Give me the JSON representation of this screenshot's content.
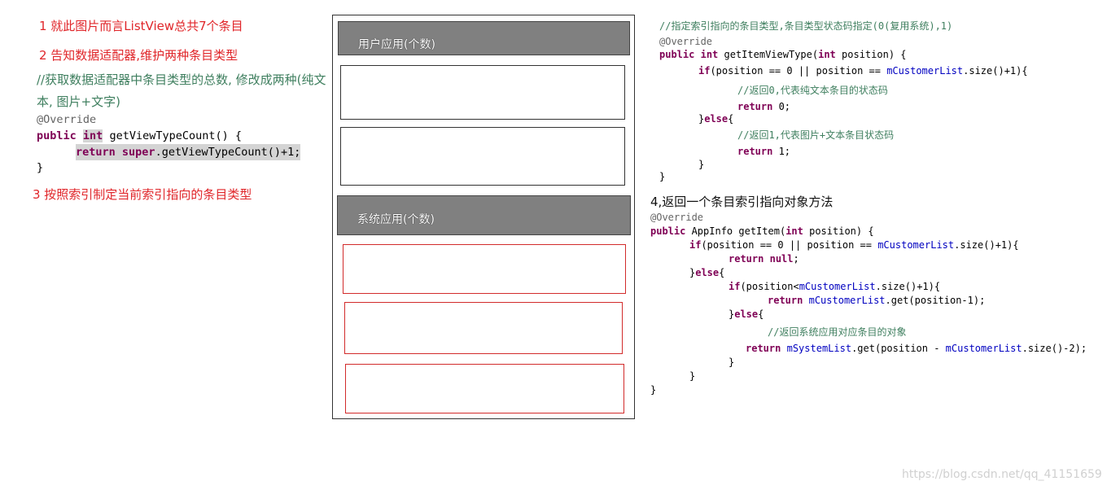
{
  "left": {
    "note1": "1 就此图片而言ListView总共7个条目",
    "note2": "2 告知数据适配器,维护两种条目类型",
    "comment_line1": "//获取数据适配器中条目类型的总数, 修改成两种(纯文",
    "comment_line2": "本, 图片+文字)",
    "code": {
      "annotation": "@Override",
      "sig_public": "public",
      "sig_int": "int",
      "sig_rest": " getViewTypeCount() {",
      "ret_return": "return",
      "ret_super": "super",
      "ret_rest": ".getViewTypeCount()+1;",
      "close": "}"
    },
    "note3": "3  按照索引制定当前索引指向的条目类型"
  },
  "phone": {
    "user_header": "用户应用(个数)",
    "system_header": "系统应用(个数)"
  },
  "right_top": {
    "comment": "//指定索引指向的条目类型,条目类型状态码指定(0(复用系统),1)",
    "annotation": "@Override",
    "l1_public": "public",
    "l1_int": "int",
    "l1_name": " getItemViewType(",
    "l1_int2": "int",
    "l1_rest": " position) {",
    "l2_if": "if",
    "l2_a": "(position == 0 || position == ",
    "l2_field": "mCustomerList",
    "l2_b": ".size()+1){",
    "l3_comment": "//返回0,代表纯文本条目的状态码",
    "l4_return": "return",
    "l4_rest": " 0;",
    "l5": "}",
    "l5_else": "else",
    "l5_b": "{",
    "l6_comment": "//返回1,代表图片+文本条目状态码",
    "l7_return": "return",
    "l7_rest": " 1;",
    "l8": "}",
    "l9": "}"
  },
  "right_bottom": {
    "heading": "4,返回一个条目索引指向对象方法",
    "annotation": "@Override",
    "l1_public": "public",
    "l1_a": " AppInfo getItem(",
    "l1_int": "int",
    "l1_b": " position) {",
    "l2_if": "if",
    "l2_a": "(position == 0 || position == ",
    "l2_field": "mCustomerList",
    "l2_b": ".size()+1){",
    "l3_return": "return",
    "l3_null": "null",
    "l3_semi": ";",
    "l4_a": "}",
    "l4_else": "else",
    "l4_b": "{",
    "l5_if": "if",
    "l5_a": "(position<",
    "l5_field": "mCustomerList",
    "l5_b": ".size()+1){",
    "l6_return": "return",
    "l6_field": "mCustomerList",
    "l6_b": ".get(position-1);",
    "l7_a": "}",
    "l7_else": "else",
    "l7_b": "{",
    "l8_comment": "//返回系统应用对应条目的对象",
    "l9_return": "return",
    "l9_field": "mSystemList",
    "l9_a": ".get(position - ",
    "l9_field2": "mCustomerList",
    "l9_b": ".size()-2);",
    "l10": "}",
    "l11": "}",
    "l12": "}"
  },
  "watermark": "https://blog.csdn.net/qq_41151659",
  "colors": {
    "note_red": "#e0262a",
    "comment_green": "#3f7f5f",
    "keyword": "#7f0055",
    "field_blue": "#0000c0",
    "header_gray": "#808080"
  }
}
